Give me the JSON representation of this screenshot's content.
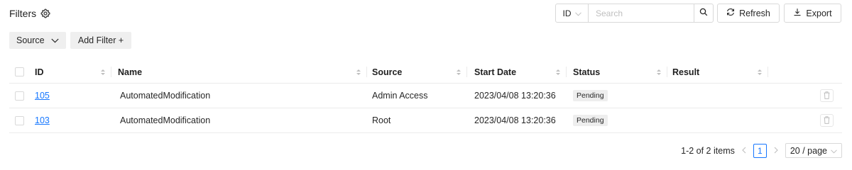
{
  "header": {
    "title": "Filters",
    "icon": "gear-icon"
  },
  "toolbar": {
    "search_field": "ID",
    "search_placeholder": "Search",
    "search_value": "",
    "refresh_label": "Refresh",
    "export_label": "Export"
  },
  "filters": {
    "source_label": "Source",
    "add_filter_label": "Add Filter +"
  },
  "table": {
    "columns": [
      "ID",
      "Name",
      "Source",
      "Start Date",
      "Status",
      "Result"
    ],
    "rows": [
      {
        "id": "105",
        "name": "AutomatedModification",
        "source": "Admin Access",
        "start_date": "2023/04/08 13:20:36",
        "status": "Pending",
        "result": ""
      },
      {
        "id": "103",
        "name": "AutomatedModification",
        "source": "Root",
        "start_date": "2023/04/08 13:20:36",
        "status": "Pending",
        "result": ""
      }
    ]
  },
  "pagination": {
    "summary": "1-2 of 2 items",
    "current_page": "1",
    "page_size": "20 / page"
  },
  "colors": {
    "accent": "#1677ff",
    "border": "#d9d9d9",
    "chip_bg": "#efefef"
  }
}
